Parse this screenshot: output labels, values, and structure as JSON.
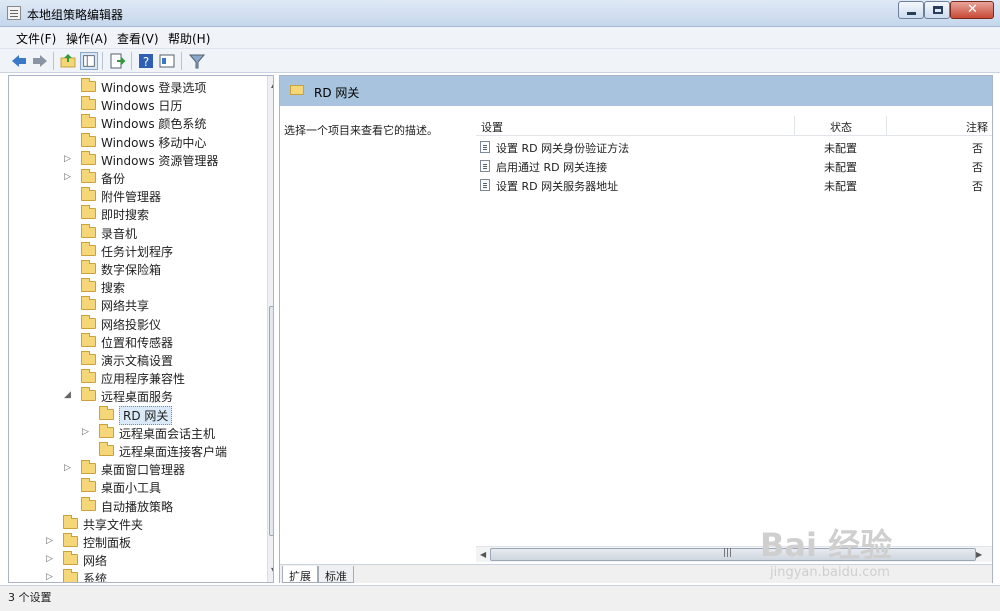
{
  "window": {
    "title": "本地组策略编辑器",
    "close_glyph": "✕"
  },
  "menu": [
    "文件(F)",
    "操作(A)",
    "查看(V)",
    "帮助(H)"
  ],
  "toolbar_icons": [
    "back-arrow-icon",
    "forward-arrow-icon",
    "up-folder-icon",
    "show-hide-tree-icon",
    "export-list-icon",
    "help-icon",
    "properties-icon",
    "filter-icon"
  ],
  "tree": [
    {
      "label": "Windows 登录选项",
      "level": 2,
      "arrow": ""
    },
    {
      "label": "Windows 日历",
      "level": 2,
      "arrow": ""
    },
    {
      "label": "Windows 颜色系统",
      "level": 2,
      "arrow": ""
    },
    {
      "label": "Windows 移动中心",
      "level": 2,
      "arrow": ""
    },
    {
      "label": "Windows 资源管理器",
      "level": 2,
      "arrow": "▷"
    },
    {
      "label": "备份",
      "level": 2,
      "arrow": "▷"
    },
    {
      "label": "附件管理器",
      "level": 2,
      "arrow": ""
    },
    {
      "label": "即时搜索",
      "level": 2,
      "arrow": ""
    },
    {
      "label": "录音机",
      "level": 2,
      "arrow": ""
    },
    {
      "label": "任务计划程序",
      "level": 2,
      "arrow": ""
    },
    {
      "label": "数字保险箱",
      "level": 2,
      "arrow": ""
    },
    {
      "label": "搜索",
      "level": 2,
      "arrow": ""
    },
    {
      "label": "网络共享",
      "level": 2,
      "arrow": ""
    },
    {
      "label": "网络投影仪",
      "level": 2,
      "arrow": ""
    },
    {
      "label": "位置和传感器",
      "level": 2,
      "arrow": ""
    },
    {
      "label": "演示文稿设置",
      "level": 2,
      "arrow": ""
    },
    {
      "label": "应用程序兼容性",
      "level": 2,
      "arrow": ""
    },
    {
      "label": "远程桌面服务",
      "level": 2,
      "arrow": "◢"
    },
    {
      "label": "RD 网关",
      "level": 3,
      "arrow": "",
      "selected": true
    },
    {
      "label": "远程桌面会话主机",
      "level": 3,
      "arrow": "▷"
    },
    {
      "label": "远程桌面连接客户端",
      "level": 3,
      "arrow": ""
    },
    {
      "label": "桌面窗口管理器",
      "level": 2,
      "arrow": "▷"
    },
    {
      "label": "桌面小工具",
      "level": 2,
      "arrow": ""
    },
    {
      "label": "自动播放策略",
      "level": 2,
      "arrow": ""
    },
    {
      "label": "共享文件夹",
      "level": 1,
      "arrow": ""
    },
    {
      "label": "控制面板",
      "level": 1,
      "arrow": "▷"
    },
    {
      "label": "网络",
      "level": 1,
      "arrow": "▷"
    },
    {
      "label": "系统",
      "level": 1,
      "arrow": "▷"
    }
  ],
  "content": {
    "folder_title": "RD 网关",
    "description_hint": "选择一个项目来查看它的描述。",
    "columns": {
      "setting": "设置",
      "state": "状态",
      "comment": "注释"
    },
    "rows": [
      {
        "setting": "设置 RD 网关身份验证方法",
        "state": "未配置",
        "comment": "否"
      },
      {
        "setting": "启用通过 RD 网关连接",
        "state": "未配置",
        "comment": "否"
      },
      {
        "setting": "设置 RD 网关服务器地址",
        "state": "未配置",
        "comment": "否"
      }
    ],
    "hscroll_grip": "|||",
    "tabs": [
      "扩展",
      "标准"
    ]
  },
  "status": "3 个设置",
  "watermark": {
    "logo": "Bai 经验",
    "url": "jingyan.baidu.com"
  },
  "colors": {
    "header_band": "#a8c3dd",
    "selection": "#dbeaf8",
    "folder": "#f5d77a"
  }
}
